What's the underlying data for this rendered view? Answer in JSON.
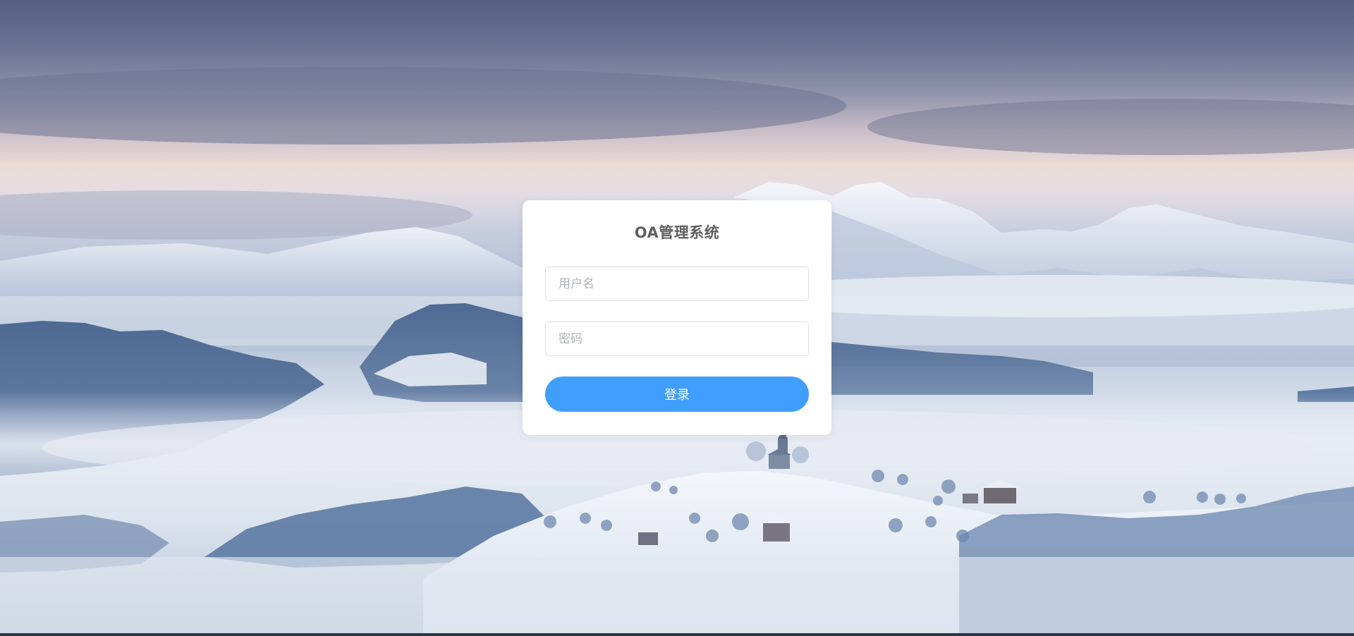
{
  "app": {
    "title": "OA管理系统"
  },
  "login_form": {
    "username": {
      "value": "",
      "placeholder": "用户名"
    },
    "password": {
      "value": "",
      "placeholder": "密码"
    },
    "submit_label": "登录"
  },
  "colors": {
    "primary_button": "#409eff",
    "card_background": "#ffffff",
    "title_text": "#5f5f5f"
  }
}
